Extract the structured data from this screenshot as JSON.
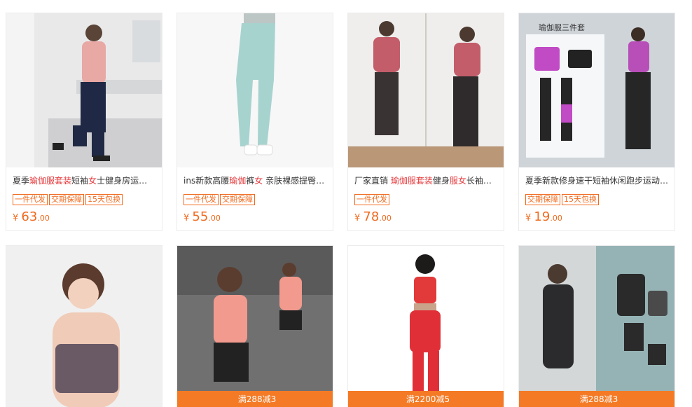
{
  "products": [
    {
      "title_parts": [
        {
          "text": "夏季",
          "hl": false
        },
        {
          "text": "瑜伽服套装",
          "hl": true
        },
        {
          "text": "短袖",
          "hl": false
        },
        {
          "text": "女",
          "hl": true
        },
        {
          "text": "士健身房运动…",
          "hl": false
        }
      ],
      "tags": [
        "一件代发",
        "交期保障",
        "15天包换"
      ],
      "price_symbol": "¥",
      "price_int": "63",
      "price_dec": ".00",
      "image_desc": "woman-pink-tee-navy-joggers-icon"
    },
    {
      "title_parts": [
        {
          "text": "ins新款高腰",
          "hl": false
        },
        {
          "text": "瑜伽",
          "hl": true
        },
        {
          "text": "裤",
          "hl": false
        },
        {
          "text": "女",
          "hl": true
        },
        {
          "text": " 亲肤裸感提臀…",
          "hl": false
        }
      ],
      "tags": [
        "一件代发",
        "交期保障"
      ],
      "price_symbol": "¥",
      "price_int": "55",
      "price_dec": ".00",
      "image_desc": "mint-leggings-icon"
    },
    {
      "title_parts": [
        {
          "text": "厂家直销 ",
          "hl": false
        },
        {
          "text": "瑜伽服套装",
          "hl": true
        },
        {
          "text": "健身",
          "hl": false
        },
        {
          "text": "服女",
          "hl": true
        },
        {
          "text": "长袖…",
          "hl": false
        }
      ],
      "tags": [
        "一件代发"
      ],
      "price_symbol": "¥",
      "price_int": "78",
      "price_dec": ".00",
      "image_desc": "two-women-pink-longsleeve-icon"
    },
    {
      "title_parts": [
        {
          "text": "夏季新款修身速干短袖休闲跑步运动…",
          "hl": false
        }
      ],
      "tags": [
        "交期保障",
        "15天包换"
      ],
      "price_symbol": "¥",
      "price_int": "19",
      "price_dec": ".00",
      "image_desc": "three-piece-set-icon",
      "image_caption": "瑜伽服三件套"
    },
    {
      "image_desc": "woman-purple-crop-top-icon",
      "promo": ""
    },
    {
      "image_desc": "woman-coral-tee-shorts-icon",
      "promo": "满288减3"
    },
    {
      "image_desc": "woman-red-mesh-set-icon",
      "promo": "满2200减5"
    },
    {
      "image_desc": "woman-grey-longsleeve-set-icon",
      "promo": "满288减3"
    }
  ]
}
